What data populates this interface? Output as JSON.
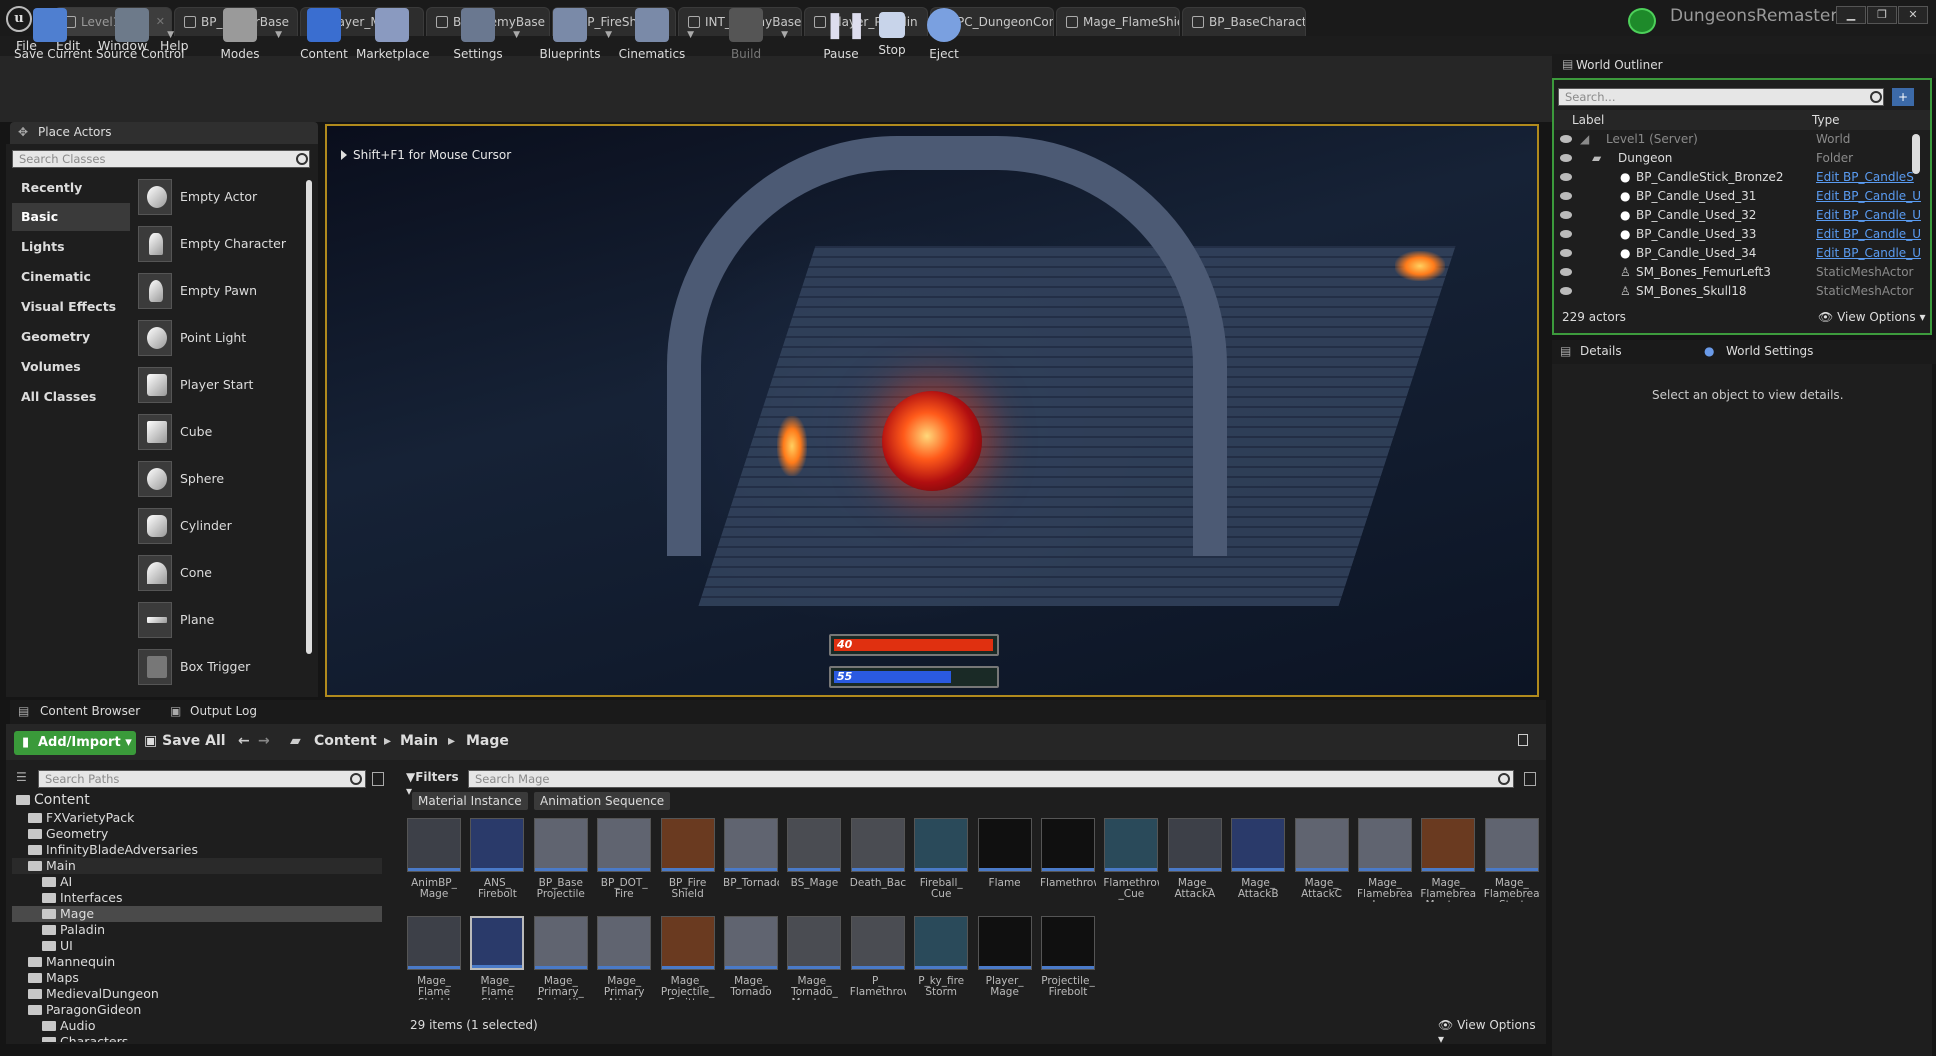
{
  "doc_tabs": [
    {
      "label": "Level1 •",
      "active": true
    },
    {
      "label": "BP_PlayerBase"
    },
    {
      "label": "Player_Mage"
    },
    {
      "label": "BP_EnemyBase"
    },
    {
      "label": "BP_FireShield"
    },
    {
      "label": "INT_EnemyBase"
    },
    {
      "label": "Player_Paladin"
    },
    {
      "label": "PC_DungeonContrc"
    },
    {
      "label": "Mage_FlameShield"
    },
    {
      "label": "BP_BaseCharacter•"
    }
  ],
  "project_name": "DungeonsRemaster",
  "menu": [
    "File",
    "Edit",
    "Window",
    "Help"
  ],
  "toolbar": [
    {
      "label": "Save Current",
      "icon": "save-icon"
    },
    {
      "label": "Source Control",
      "icon": "source-control-icon"
    },
    {
      "label": "Modes",
      "icon": "modes-icon"
    },
    {
      "label": "Content",
      "icon": "content-icon"
    },
    {
      "label": "Marketplace",
      "icon": "marketplace-icon"
    },
    {
      "label": "Settings",
      "icon": "settings-icon"
    },
    {
      "label": "Blueprints",
      "icon": "blueprints-icon"
    },
    {
      "label": "Cinematics",
      "icon": "cinematics-icon"
    },
    {
      "label": "Build",
      "icon": "build-icon"
    },
    {
      "label": "Pause",
      "icon": "pause-icon"
    },
    {
      "label": "Stop",
      "icon": "stop-icon"
    },
    {
      "label": "Eject",
      "icon": "eject-icon"
    }
  ],
  "place_actors": {
    "title": "Place Actors",
    "search_placeholder": "Search Classes",
    "categories": [
      "Recently Placed",
      "Basic",
      "Lights",
      "Cinematic",
      "Visual Effects",
      "Geometry",
      "Volumes",
      "All Classes"
    ],
    "items": [
      "Empty Actor",
      "Empty Character",
      "Empty Pawn",
      "Point Light",
      "Player Start",
      "Cube",
      "Sphere",
      "Cylinder",
      "Cone",
      "Plane",
      "Box Trigger"
    ]
  },
  "viewport": {
    "hint": "Shift+F1 for Mouse Cursor",
    "health_value": "40",
    "mana_value": "55",
    "health_fraction": 0.98,
    "mana_fraction": 0.72,
    "health_color": "#e03010",
    "mana_color": "#2a5ae0"
  },
  "outliner": {
    "title": "World Outliner",
    "search_placeholder": "Search...",
    "col_label": "Label",
    "col_type": "Type",
    "rows": [
      {
        "label": "Level1 (Server)",
        "type": "World"
      },
      {
        "label": "Dungeon",
        "type": "Folder"
      },
      {
        "label": "BP_CandleStick_Bronze2",
        "type": "Edit BP_CandleS"
      },
      {
        "label": "BP_Candle_Used_31",
        "type": "Edit BP_Candle_U"
      },
      {
        "label": "BP_Candle_Used_32",
        "type": "Edit BP_Candle_U"
      },
      {
        "label": "BP_Candle_Used_33",
        "type": "Edit BP_Candle_U"
      },
      {
        "label": "BP_Candle_Used_34",
        "type": "Edit BP_Candle_U"
      },
      {
        "label": "SM_Bones_FemurLeft3",
        "type": "StaticMeshActor"
      },
      {
        "label": "SM_Bones_Skull18",
        "type": "StaticMeshActor"
      }
    ],
    "count": "229 actors",
    "view_options": "View Options"
  },
  "details": {
    "tab": "Details",
    "tab2": "World Settings",
    "empty_text": "Select an object to view details."
  },
  "content_browser": {
    "tab": "Content Browser",
    "tab2": "Output Log",
    "add_import": "Add/Import",
    "save_all": "Save All",
    "crumbs": [
      "Content",
      "Main",
      "Mage"
    ],
    "search_paths_placeholder": "Search Paths",
    "filters": "Filters",
    "search_placeholder": "Search Mage",
    "chips": [
      "Material Instance",
      "Animation Sequence"
    ],
    "tree": [
      {
        "label": "Content",
        "depth": 0
      },
      {
        "label": "FXVarietyPack",
        "depth": 1
      },
      {
        "label": "Geometry",
        "depth": 1
      },
      {
        "label": "InfinityBladeAdversaries",
        "depth": 1
      },
      {
        "label": "Main",
        "depth": 1
      },
      {
        "label": "AI",
        "depth": 2
      },
      {
        "label": "Interfaces",
        "depth": 2
      },
      {
        "label": "Mage",
        "depth": 2,
        "selected": true
      },
      {
        "label": "Paladin",
        "depth": 2
      },
      {
        "label": "UI",
        "depth": 2
      },
      {
        "label": "Mannequin",
        "depth": 1
      },
      {
        "label": "Maps",
        "depth": 1
      },
      {
        "label": "MedievalDungeon",
        "depth": 1
      },
      {
        "label": "ParagonGideon",
        "depth": 1
      },
      {
        "label": "Audio",
        "depth": 2
      },
      {
        "label": "Characters",
        "depth": 2
      }
    ],
    "assets_row1": [
      "AnimBP_ Mage",
      "ANS_ Firebolt",
      "BP_Base Projectile",
      "BP_DOT_ Fire",
      "BP_Fire Shield",
      "BP_Tornado",
      "BS_Mage",
      "Death_Back",
      "Fireball_ Cue",
      "Flame",
      "Flamethrowe",
      "Flamethrowe _Cue",
      "Mage_ AttackA",
      "Mage_ AttackB",
      "Mage_ AttackC",
      "Mage_ Flamebreath Loop",
      "Mage_ Flamebreath Montage",
      "Mage_ Flamebreath Start"
    ],
    "assets_row2": [
      "Mage_ Flame Shield",
      "Mage_ Flame Shield",
      "Mage_ Primary_ Projectile",
      "Mage_ Primary Attack",
      "Mage_ Projectile_ Emitter",
      "Mage_ Tornado",
      "Mage_ Tornado_ Montage",
      "P_ Flamethrowe",
      "P_ky_fire Storm",
      "Player_ Mage",
      "Projectile_ Firebolt"
    ],
    "count": "29 items (1 selected)",
    "view_options": "View Options"
  }
}
